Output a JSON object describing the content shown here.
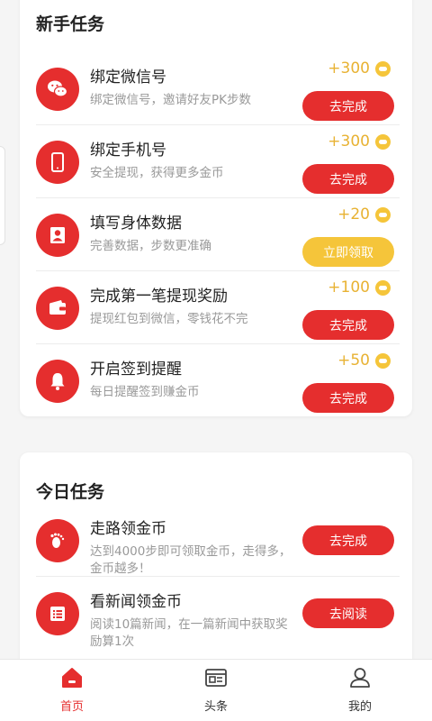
{
  "newbie": {
    "title": "新手任务",
    "tasks": [
      {
        "title": "绑定微信号",
        "subtitle": "绑定微信号，邀请好友PK步数",
        "reward": "+300",
        "action": "去完成",
        "icon": "wechat-icon"
      },
      {
        "title": "绑定手机号",
        "subtitle": "安全提现，获得更多金币",
        "reward": "+300",
        "action": "去完成",
        "icon": "phone-icon"
      },
      {
        "title": "填写身体数据",
        "subtitle": "完善数据，步数更准确",
        "reward": "+20",
        "action": "立即领取",
        "icon": "person-icon"
      },
      {
        "title": "完成第一笔提现奖励",
        "subtitle": "提现红包到微信，零钱花不完",
        "reward": "+100",
        "action": "去完成",
        "icon": "wallet-icon"
      },
      {
        "title": "开启签到提醒",
        "subtitle": "每日提醒签到赚金币",
        "reward": "+50",
        "action": "去完成",
        "icon": "bell-icon"
      }
    ]
  },
  "today": {
    "title": "今日任务",
    "tasks": [
      {
        "title": "走路领金币",
        "subtitle": "达到4000步即可领取金币，走得多，金币越多！",
        "action": "去完成",
        "icon": "footprint-icon"
      },
      {
        "title": "看新闻领金币",
        "subtitle": "阅读10篇新闻，在一篇新闻中获取奖励算1次",
        "action": "去阅读",
        "icon": "news-icon"
      }
    ]
  },
  "tabbar": {
    "items": [
      {
        "label": "首页",
        "icon": "home-icon",
        "active": true
      },
      {
        "label": "头条",
        "icon": "newspaper-icon",
        "active": false
      },
      {
        "label": "我的",
        "icon": "user-icon",
        "active": false
      }
    ]
  },
  "colors": {
    "accent": "#e52e2e",
    "reward": "#e8b233",
    "claim_button": "#f5c53a"
  }
}
